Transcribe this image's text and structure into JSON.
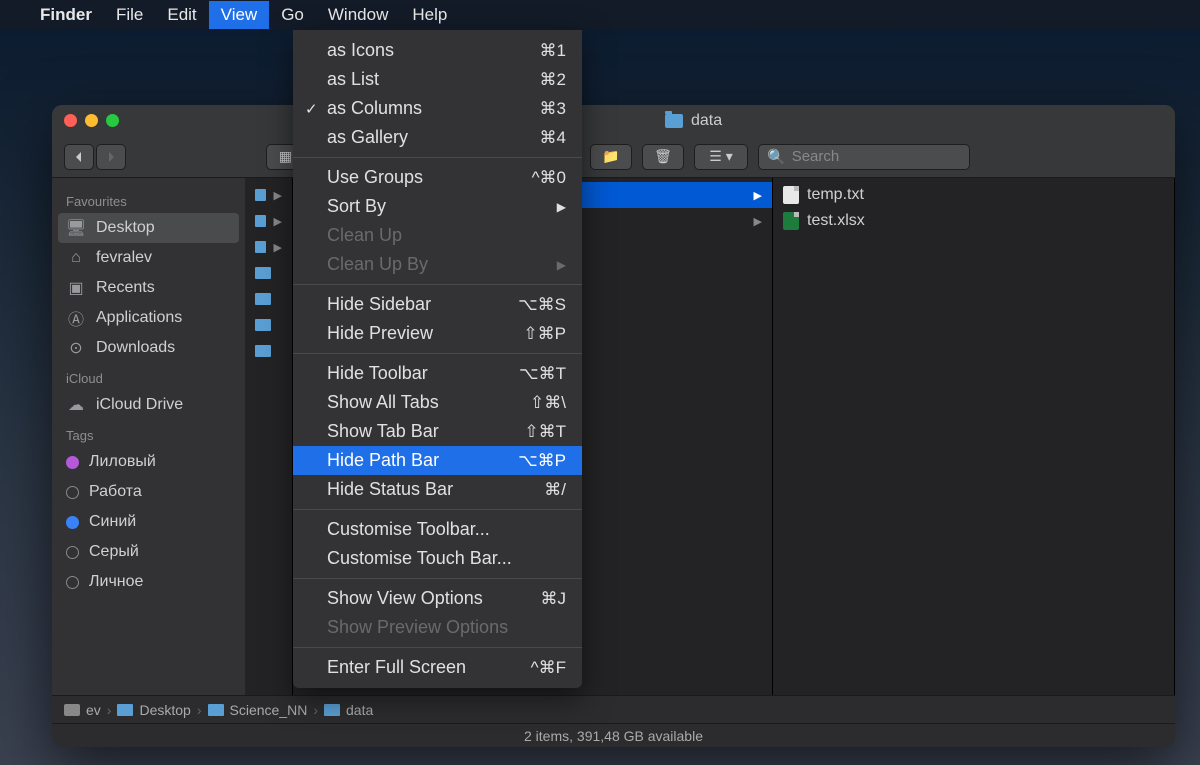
{
  "menubar": {
    "app": "Finder",
    "items": [
      "File",
      "Edit",
      "View",
      "Go",
      "Window",
      "Help"
    ],
    "active_index": 2
  },
  "dropdown": {
    "groups": [
      [
        {
          "label": "as Icons",
          "shortcut": "⌘1"
        },
        {
          "label": "as List",
          "shortcut": "⌘2"
        },
        {
          "label": "as Columns",
          "shortcut": "⌘3",
          "checked": true
        },
        {
          "label": "as Gallery",
          "shortcut": "⌘4"
        }
      ],
      [
        {
          "label": "Use Groups",
          "shortcut": "^⌘0"
        },
        {
          "label": "Sort By",
          "submenu": true
        },
        {
          "label": "Clean Up",
          "disabled": true
        },
        {
          "label": "Clean Up By",
          "disabled": true,
          "submenu": true
        }
      ],
      [
        {
          "label": "Hide Sidebar",
          "shortcut": "⌥⌘S"
        },
        {
          "label": "Hide Preview",
          "shortcut": "⇧⌘P"
        }
      ],
      [
        {
          "label": "Hide Toolbar",
          "shortcut": "⌥⌘T"
        },
        {
          "label": "Show All Tabs",
          "shortcut": "⇧⌘\\"
        },
        {
          "label": "Show Tab Bar",
          "shortcut": "⇧⌘T"
        },
        {
          "label": "Hide Path Bar",
          "shortcut": "⌥⌘P",
          "highlighted": true
        },
        {
          "label": "Hide Status Bar",
          "shortcut": "⌘/"
        }
      ],
      [
        {
          "label": "Customise Toolbar..."
        },
        {
          "label": "Customise Touch Bar..."
        }
      ],
      [
        {
          "label": "Show View Options",
          "shortcut": "⌘J"
        },
        {
          "label": "Show Preview Options",
          "disabled": true
        }
      ],
      [
        {
          "label": "Enter Full Screen",
          "shortcut": "^⌘F"
        }
      ]
    ]
  },
  "window": {
    "title": "data",
    "search_placeholder": "Search"
  },
  "sidebar": {
    "sections": [
      {
        "title": "Favourites",
        "items": [
          {
            "label": "Desktop",
            "icon": "desktop",
            "selected": true
          },
          {
            "label": "fevralev",
            "icon": "home"
          },
          {
            "label": "Recents",
            "icon": "recents"
          },
          {
            "label": "Applications",
            "icon": "apps"
          },
          {
            "label": "Downloads",
            "icon": "downloads"
          }
        ]
      },
      {
        "title": "iCloud",
        "items": [
          {
            "label": "iCloud Drive",
            "icon": "icloud"
          }
        ]
      },
      {
        "title": "Tags",
        "items": [
          {
            "label": "Лиловый",
            "tag": "purple"
          },
          {
            "label": "Работа",
            "tag": "hollow"
          },
          {
            "label": "Синий",
            "tag": "blue"
          },
          {
            "label": "Серый",
            "tag": "hollow"
          },
          {
            "label": "Личное",
            "tag": "hollow"
          }
        ]
      }
    ]
  },
  "columns": {
    "col2_selected": "",
    "col3_items": [
      {
        "label": "temp.txt",
        "type": "txt"
      },
      {
        "label": "test.xlsx",
        "type": "xlsx"
      }
    ]
  },
  "pathbar": [
    "ev",
    "Desktop",
    "Science_NN",
    "data"
  ],
  "status": "2 items, 391,48 GB available"
}
